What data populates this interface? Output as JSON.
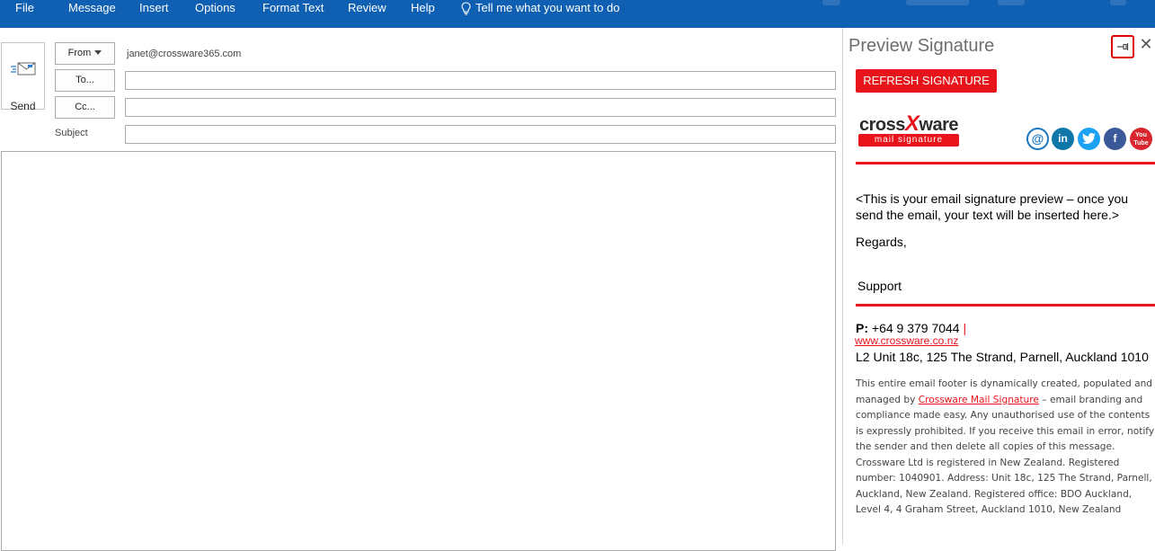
{
  "ribbon": {
    "tabs": [
      "File",
      "Message",
      "Insert",
      "Options",
      "Format Text",
      "Review",
      "Help"
    ],
    "tell_me": "Tell me what you want to do"
  },
  "compose": {
    "send_label": "Send",
    "from_label": "From",
    "from_value": "janet@crossware365.com",
    "to_label": "To...",
    "cc_label": "Cc...",
    "subject_label": "Subject",
    "to_value": "",
    "cc_value": "",
    "subject_value": ""
  },
  "preview": {
    "title": "Preview Signature",
    "refresh_label": "REFRESH SIGNATURE",
    "logo_word_start": "cross",
    "logo_word_x": "X",
    "logo_word_end": "ware",
    "logo_tagline": "mail signature",
    "social_icons": [
      "email-icon",
      "linkedin-icon",
      "twitter-icon",
      "facebook-icon",
      "youtube-icon"
    ],
    "preview_message": "<This is your email signature preview – once you send the email, your text will be inserted here.>",
    "regards": "Regards,",
    "name": "Support",
    "phone_label": "P:",
    "phone_value": "+64 9 379 7044",
    "phone_sep": "|",
    "website": "www.crossware.co.nz",
    "address": "L2 Unit 18c, 125 The Strand, Parnell, Auckland 1010",
    "disclaimer_part1": "This entire email footer is dynamically created, populated and managed by ",
    "disclaimer_link": "Crossware Mail Signature",
    "disclaimer_part2": " – email branding and compliance made easy. Any unauthorised use of the contents is expressly prohibited. If you receive this email in error, notify the sender and then delete all copies of this message. Crossware Ltd is registered in New Zealand. Registered number: 1040901. Address: Unit 18c, 125 The Strand, Parnell, Auckland, New Zealand. Registered office: BDO Auckland, Level 4, 4 Graham Street, Auckland 1010, New Zealand"
  },
  "colors": {
    "ribbon": "#0f5fb3",
    "brand_red": "#e8141b"
  }
}
